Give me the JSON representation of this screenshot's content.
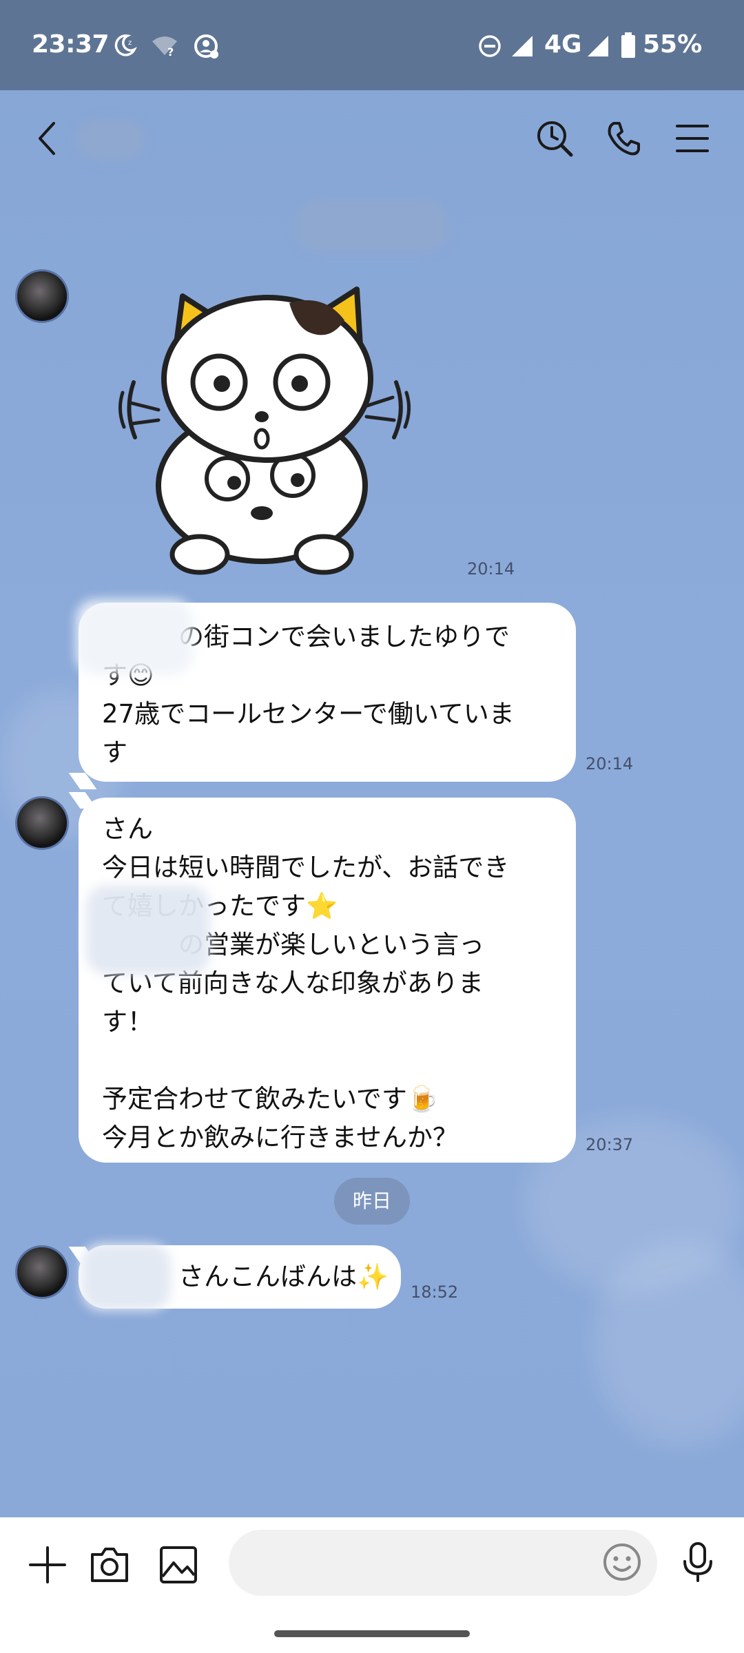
{
  "status_bar": {
    "time": "23:37",
    "network": "4G",
    "battery": "55%",
    "icons": [
      "moon-icon",
      "wifi-question-icon",
      "sync-account-icon",
      "dnd-icon",
      "signal-icon",
      "signal-icon",
      "battery-icon"
    ]
  },
  "header": {
    "contact_name": "",
    "icons": [
      "back-icon",
      "timeline-search-icon",
      "phone-icon",
      "menu-icon"
    ]
  },
  "messages": [
    {
      "type": "sticker",
      "sender": "other",
      "time": "20:14",
      "sticker_name": "tabby-cat-sticker"
    },
    {
      "type": "text",
      "sender": "other",
      "time": "20:14",
      "lines": [
        "　　　の街コンで会いましたゆりで",
        "す😊",
        "27歳でコールセンターで働いていま",
        "す"
      ]
    },
    {
      "type": "text",
      "sender": "other",
      "time": "20:37",
      "lines": [
        "さん",
        "今日は短い時間でしたが、お話でき",
        "て嬉しかったです⭐",
        "　　　の営業が楽しいという言っ",
        "ていて前向きな人な印象がありま",
        "す！",
        "",
        "予定合わせて飲みたいです🍺",
        "今月とか飲みに行きませんか？"
      ]
    },
    {
      "type": "date",
      "label": "昨日"
    },
    {
      "type": "text",
      "sender": "other",
      "time": "18:52",
      "lines": [
        "　　　さんこんばんは✨"
      ]
    }
  ],
  "input_bar": {
    "placeholder": "",
    "icons": [
      "plus-icon",
      "camera-icon",
      "image-icon",
      "emoji-icon",
      "microphone-icon"
    ]
  },
  "colors": {
    "background": "#8CAADA",
    "status_bar": "#5E7494",
    "bubble": "#FFFFFF",
    "date_chip": "#7D95BD"
  }
}
